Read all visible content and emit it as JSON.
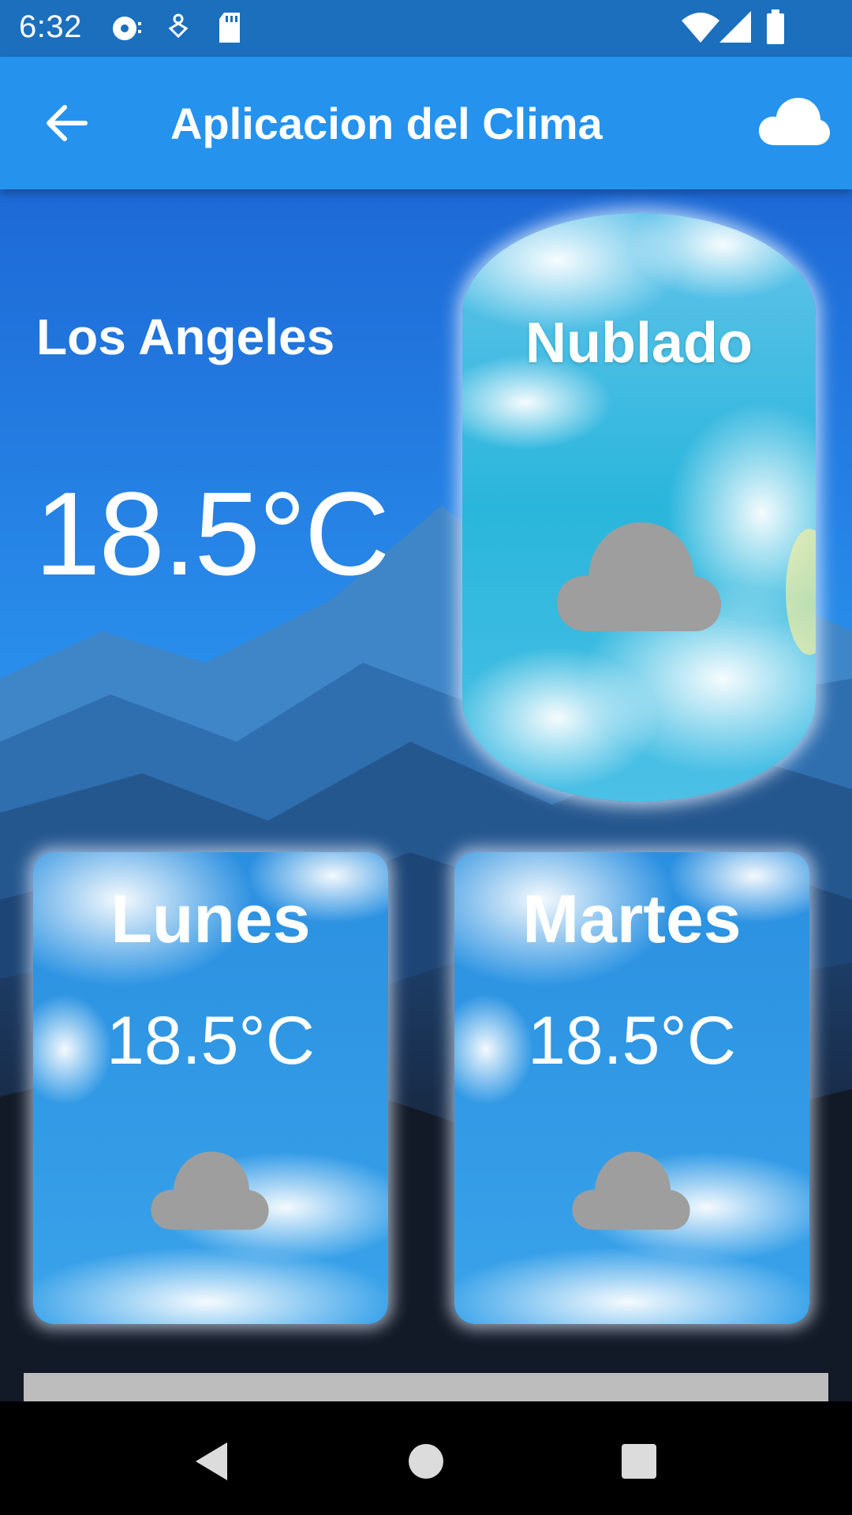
{
  "status_bar": {
    "time": "6:32",
    "icons": [
      "media-icon",
      "location-icon",
      "sd-card-icon",
      "wifi-icon",
      "signal-icon",
      "battery-icon"
    ]
  },
  "app_bar": {
    "title": "Aplicacion del Clima",
    "back_icon": "arrow-left-icon",
    "action_icon": "cloud-icon"
  },
  "current": {
    "city": "Los Angeles",
    "temperature": "18.5°C",
    "condition": "Nublado",
    "condition_icon": "cloud-icon"
  },
  "forecast": [
    {
      "day": "Lunes",
      "temperature": "18.5°C",
      "icon": "cloud-icon"
    },
    {
      "day": "Martes",
      "temperature": "18.5°C",
      "icon": "cloud-icon"
    }
  ],
  "nav_bar": {
    "icons": [
      "back-triangle-icon",
      "home-circle-icon",
      "recents-square-icon"
    ]
  },
  "colors": {
    "status_bar": "#1c6fbd",
    "app_bar": "#2592ee",
    "cloud_icon": "#9e9e9e",
    "text": "#ffffff"
  }
}
